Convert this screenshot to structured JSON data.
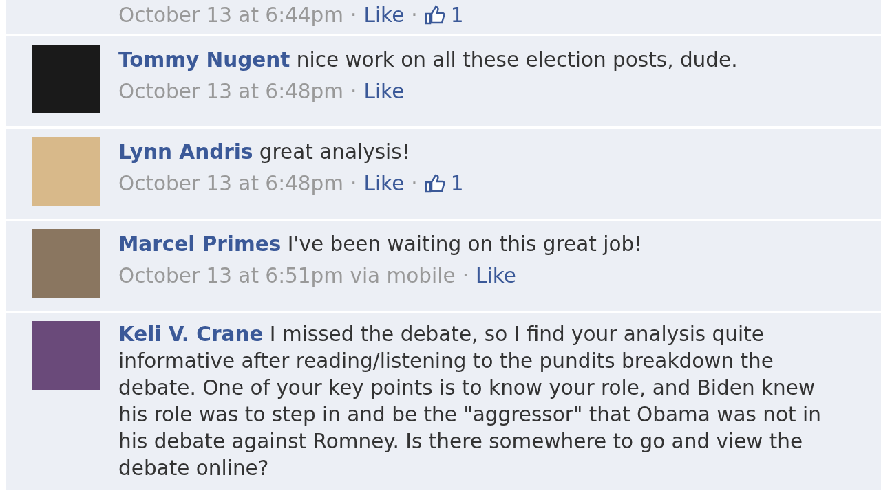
{
  "comments": [
    {
      "partial": true,
      "time": "October 13 at 6:44pm",
      "sep1": "·",
      "like": "Like",
      "sep2": "·",
      "likes": "1"
    },
    {
      "author": "Tommy Nugent",
      "text": "nice work on all these election posts, dude.",
      "time": "October 13 at 6:48pm",
      "sep1": "·",
      "like": "Like"
    },
    {
      "author": "Lynn Andris",
      "text": "great analysis!",
      "time": "October 13 at 6:48pm",
      "sep1": "·",
      "like": "Like",
      "sep2": "·",
      "likes": "1"
    },
    {
      "author": "Marcel Primes",
      "text": "I've been waiting on this great job!",
      "time": "October 13 at 6:51pm via mobile",
      "sep1": "·",
      "like": "Like"
    },
    {
      "author": "Keli V. Crane",
      "text": "I missed the debate, so I find your analysis quite informative after reading/listening to the pundits breakdown the debate. One of your key points is to know your role, and Biden knew his role was to step in and be the \"aggressor\" that Obama was not in his debate against Romney. Is there somewhere to go and view the debate online?"
    }
  ]
}
